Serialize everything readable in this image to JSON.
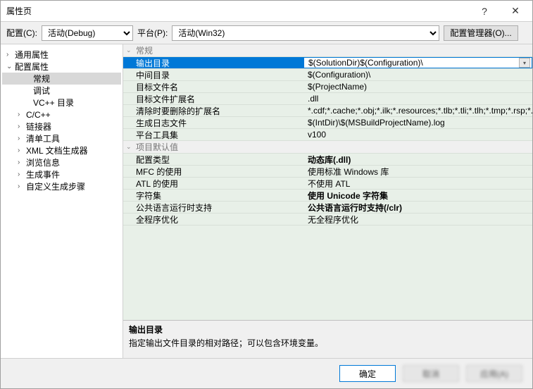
{
  "window": {
    "title": "属性页",
    "help": "?",
    "close": "✕"
  },
  "toolbar": {
    "config_label": "配置(C):",
    "config_value": "活动(Debug)",
    "platform_label": "平台(P):",
    "platform_value": "活动(Win32)",
    "config_manager": "配置管理器(O)..."
  },
  "tree": {
    "general_props": "通用属性",
    "config_props": "配置属性",
    "items": {
      "general": "常规",
      "debug": "调试",
      "vcpp_dirs": "VC++ 目录",
      "ccpp": "C/C++",
      "linker": "链接器",
      "manifest": "清单工具",
      "xmldoc": "XML 文档生成器",
      "browse": "浏览信息",
      "build_events": "生成事件",
      "custom_build": "自定义生成步骤"
    }
  },
  "groups": {
    "general": "常规",
    "project_defaults": "项目默认值"
  },
  "props": {
    "output_dir": {
      "label": "输出目录",
      "value": "$(SolutionDir)$(Configuration)\\"
    },
    "intermediate_dir": {
      "label": "中间目录",
      "value": "$(Configuration)\\"
    },
    "target_name": {
      "label": "目标文件名",
      "value": "$(ProjectName)"
    },
    "target_ext": {
      "label": "目标文件扩展名",
      "value": ".dll"
    },
    "clean_ext": {
      "label": "清除时要删除的扩展名",
      "value": "*.cdf;*.cache;*.obj;*.ilk;*.resources;*.tlb;*.tli;*.tlh;*.tmp;*.rsp;*.pgc"
    },
    "build_log": {
      "label": "生成日志文件",
      "value": "$(IntDir)\\$(MSBuildProjectName).log"
    },
    "platform_toolset": {
      "label": "平台工具集",
      "value": "v100"
    },
    "config_type": {
      "label": "配置类型",
      "value": "动态库(.dll)"
    },
    "mfc_use": {
      "label": "MFC 的使用",
      "value": "使用标准 Windows 库"
    },
    "atl_use": {
      "label": "ATL 的使用",
      "value": "不使用 ATL"
    },
    "charset": {
      "label": "字符集",
      "value": "使用 Unicode 字符集"
    },
    "clr_support": {
      "label": "公共语言运行时支持",
      "value": "公共语言运行时支持(/clr)"
    },
    "wpo": {
      "label": "全程序优化",
      "value": "无全程序优化"
    }
  },
  "description": {
    "title": "输出目录",
    "text": "指定输出文件目录的相对路径；可以包含环境变量。"
  },
  "footer": {
    "ok": "确定",
    "cancel": "取消",
    "apply": "应用(A)"
  }
}
